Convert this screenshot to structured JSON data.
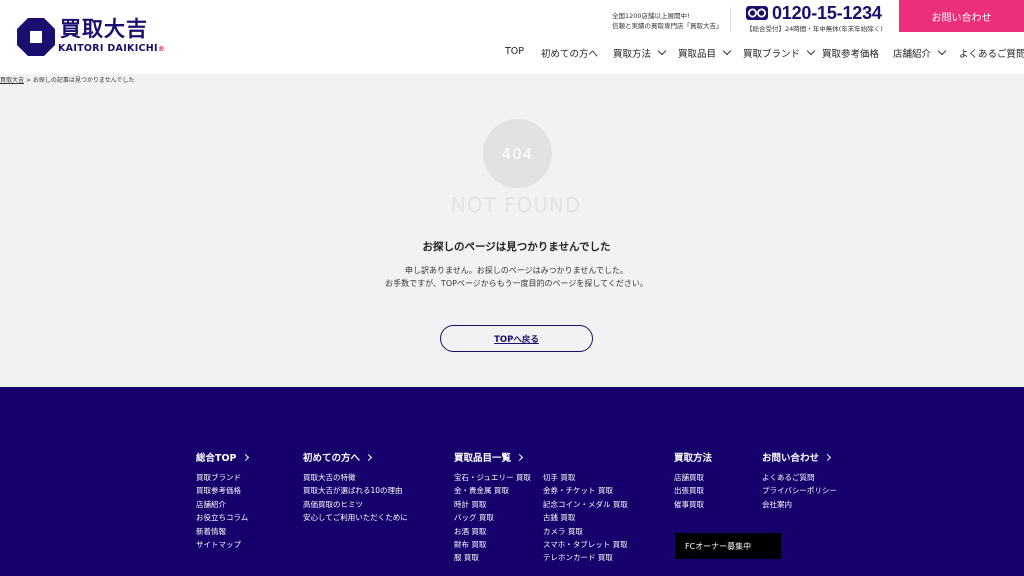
{
  "header": {
    "logo_main": "買取大吉",
    "logo_sub": "KAITORI DAIKICHI",
    "logo_mark": "®",
    "tagline_1": "全国1200店舗以上展開中!",
    "tagline_2": "信頼と実績の買取専門店「買取大吉」",
    "phone_number": "0120-15-1234",
    "phone_note": "【総合受付】24時間・年中無休(年末年始除く)",
    "contact_label": "お問い合わせ",
    "brand_color": "#1a0f6e",
    "accent_color": "#ec2f7a"
  },
  "nav": {
    "items": [
      {
        "label": "TOP",
        "dropdown": false
      },
      {
        "label": "初めての方へ",
        "dropdown": false
      },
      {
        "label": "買取方法",
        "dropdown": true
      },
      {
        "label": "買取品目",
        "dropdown": true
      },
      {
        "label": "買取ブランド",
        "dropdown": true
      },
      {
        "label": "買取参考価格",
        "dropdown": false
      },
      {
        "label": "店舗紹介",
        "dropdown": true
      },
      {
        "label": "よくあるご質問",
        "dropdown": false
      }
    ]
  },
  "breadcrumb": {
    "home": "買取大吉",
    "separator": ">",
    "current": "お探しの記事は見つかりませんでした"
  },
  "main": {
    "code": "404",
    "not_found": "NOT FOUND",
    "title": "お探しのページは見つかりませんでした",
    "body_1": "申し訳ありません。お探しのページはみつかりませんでした。",
    "body_2": "お手数ですが、TOPページからもう一度目的のページを探してください。",
    "top_button": "TOPへ戻る"
  },
  "footer": {
    "bg_color": "#16006b",
    "col1": {
      "head": "総合TOP",
      "items": [
        "買取ブランド",
        "買取参考価格",
        "店舗紹介",
        "お役立ちコラム",
        "新着情報",
        "サイトマップ"
      ]
    },
    "col2": {
      "head": "初めての方へ",
      "items": [
        "買取大吉の特徴",
        "買取大吉が選ばれる10の理由",
        "高価買取のヒミツ",
        "安心してご利用いただくために"
      ]
    },
    "col3": {
      "head": "買取品目一覧",
      "items": [
        "宝石・ジュエリー 買取",
        "金・貴金属 買取",
        "時計 買取",
        "バッグ 買取",
        "お酒 買取",
        "財布 買取",
        "服 買取"
      ]
    },
    "col4": {
      "items": [
        "切手 買取",
        "金券・チケット 買取",
        "記念コイン・メダル 買取",
        "古銭 買取",
        "カメラ 買取",
        "スマホ・タブレット 買取",
        "テレホンカード 買取"
      ]
    },
    "col5": {
      "head": "買取方法",
      "items": [
        "店舗買取",
        "出張買取",
        "催事買取"
      ]
    },
    "col6": {
      "head": "お問い合わせ",
      "items": [
        "よくあるご質問",
        "プライバシーポリシー",
        "会社案内"
      ]
    },
    "fc_button": "FCオーナー募集中"
  }
}
